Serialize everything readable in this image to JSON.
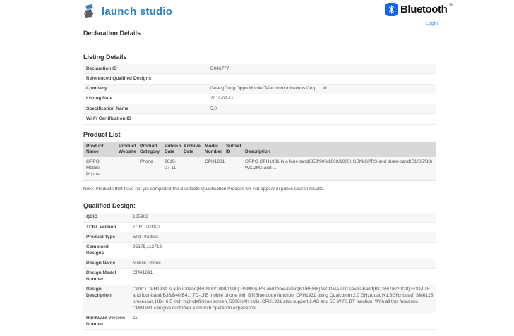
{
  "header": {
    "brand": "launch studio",
    "bluetooth_wordmark": "Bluetooth",
    "registered_mark": "®",
    "login_label": "Login",
    "brand_color": "#2e80c6",
    "bluetooth_blue": "#1467e8"
  },
  "page_title": "Declaration Details",
  "listing_details": {
    "title": "Listing Details",
    "rows": [
      {
        "label": "Declaration ID",
        "value": "D046777"
      },
      {
        "label": "Referenced Qualified Designs",
        "value": ""
      },
      {
        "label": "Company",
        "value": "GuangDong Oppo Mobile Telecommunications Corp., Ltd."
      },
      {
        "label": "Listing Date",
        "value": "2019-07-11"
      },
      {
        "label": "Specification Name",
        "value": "5.0"
      },
      {
        "label": "Wi-Fi Certification ID",
        "value": ""
      }
    ]
  },
  "product_list": {
    "title": "Product List",
    "columns": [
      "Product Name",
      "Product Website",
      "Product Category",
      "Publish Date",
      "Archive Date",
      "Model Number",
      "Subset ID",
      "Description"
    ],
    "rows": [
      {
        "product_name": "OPPO Mobile Phone",
        "product_website": "",
        "product_category": "Phone",
        "publish_date": "2019-07-11",
        "archive_date": "",
        "model_number": "CPH1931",
        "subset_id": "",
        "description": "OPPO CPH1931 is a four-band(850/900/1800/1900) GSM/GPRS and three-band(B1/B5/B8) WCDMA and ..."
      }
    ],
    "note": "Note: Products that have not yet completed the Bluetooth Qualification Process will not appear in public search results."
  },
  "qualified_design": {
    "title": "Qualified Design:",
    "rows": [
      {
        "label": "QDID",
        "value": "135962"
      },
      {
        "label": "TCRL Version",
        "value": "TCRL 2018-2"
      },
      {
        "label": "Product Type",
        "value": "End Product"
      },
      {
        "label": "Combined Designs",
        "value": "95175,112718"
      },
      {
        "label": "Design Name",
        "value": "Mobile Phone"
      },
      {
        "label": "Design Model Number",
        "value": "CPH1931"
      },
      {
        "label": "Design Description",
        "value": "OPPO CPH1931 is a four-band(850/900/1800/1900) GSM/GPRS and three-band(B1/B5/B8) WCDMA and seven-band(B1/3/5/7/8/20/28) FDD-LTE and four-band(B38/B40/B41) TD-LTE mobile phone with BT(Bluetooth) function. CPH1931 using Qualcomm 2.0 GHz(quad)+1.8GHz(quad) SM6125 processor, HD+ 6.5 inch high-definition screen, 5000mAh cells. CPH1931 also support 2.4G and 5G WIFI, BT function. With all this functions CPH1931 can give customer a smooth operation experience."
      },
      {
        "label": "Hardware Version Number",
        "value": "11"
      }
    ]
  }
}
